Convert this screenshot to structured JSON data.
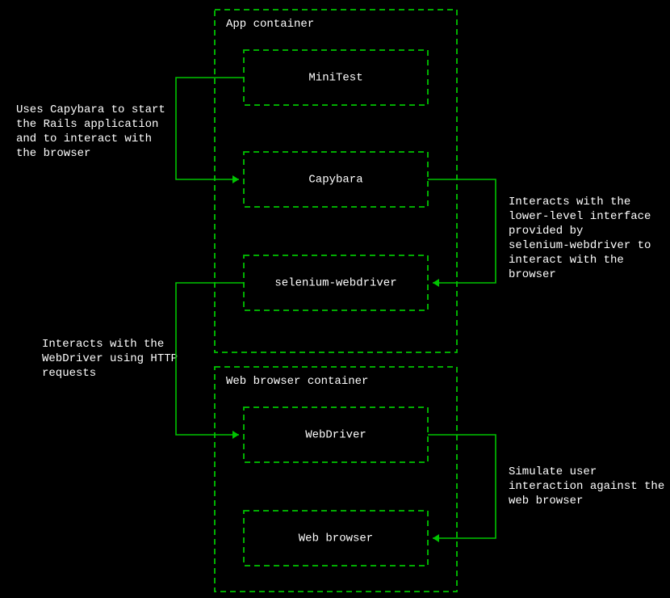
{
  "containers": {
    "app": {
      "label": "App container"
    },
    "web": {
      "label": "Web browser container"
    }
  },
  "boxes": {
    "minitest": {
      "label": "MiniTest"
    },
    "capybara": {
      "label": "Capybara"
    },
    "selenium": {
      "label": "selenium-webdriver"
    },
    "webdriver": {
      "label": "WebDriver"
    },
    "browser": {
      "label": "Web browser"
    }
  },
  "notes": {
    "n1": {
      "lines": [
        "Uses Capybara to start",
        "the Rails application",
        "and to interact with",
        "the browser"
      ]
    },
    "n2": {
      "lines": [
        "Interacts with the",
        "lower-level interface",
        "provided by",
        "selenium-webdriver to",
        "interact with the",
        "browser"
      ]
    },
    "n3": {
      "lines": [
        "Interacts with the",
        "WebDriver using HTTP",
        "requests"
      ]
    },
    "n4": {
      "lines": [
        "Simulate user",
        "interaction against the",
        "web browser"
      ]
    }
  },
  "colors": {
    "stroke": "#00c400",
    "text": "#ffffff",
    "bg": "#000000"
  }
}
